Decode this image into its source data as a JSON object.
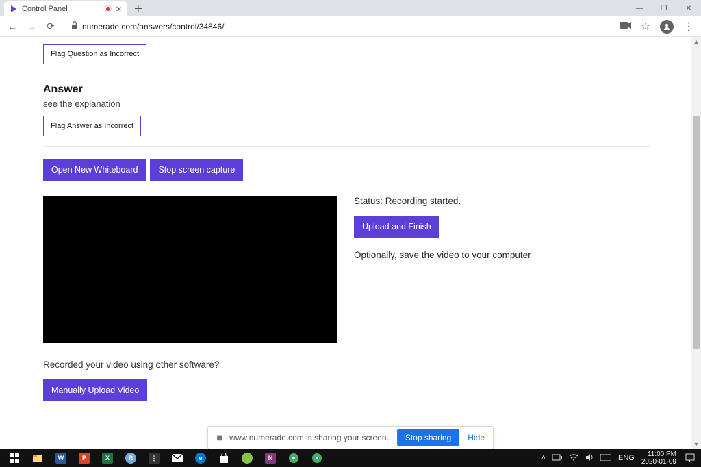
{
  "browser": {
    "tab_title": "Control Panel",
    "url": "numerade.com/answers/control/34846/"
  },
  "page": {
    "flag_question_label": "Flag Question as Incorrect",
    "answer_heading": "Answer",
    "explanation_text": "see the explanation",
    "flag_answer_label": "Flag Answer as Incorrect",
    "open_whiteboard_label": "Open New Whiteboard",
    "stop_capture_label": "Stop screen capture",
    "status_text": "Status: Recording started.",
    "upload_finish_label": "Upload and Finish",
    "optional_text": "Optionally, save the video to your computer",
    "other_software_text": "Recorded your video using other software?",
    "manual_upload_label": "Manually Upload Video"
  },
  "share_bar": {
    "message": "www.numerade.com is sharing your screen.",
    "stop_label": "Stop sharing",
    "hide_label": "Hide"
  },
  "taskbar": {
    "lang": "ENG",
    "time": "11:00 PM",
    "date": "2020-01-09"
  }
}
